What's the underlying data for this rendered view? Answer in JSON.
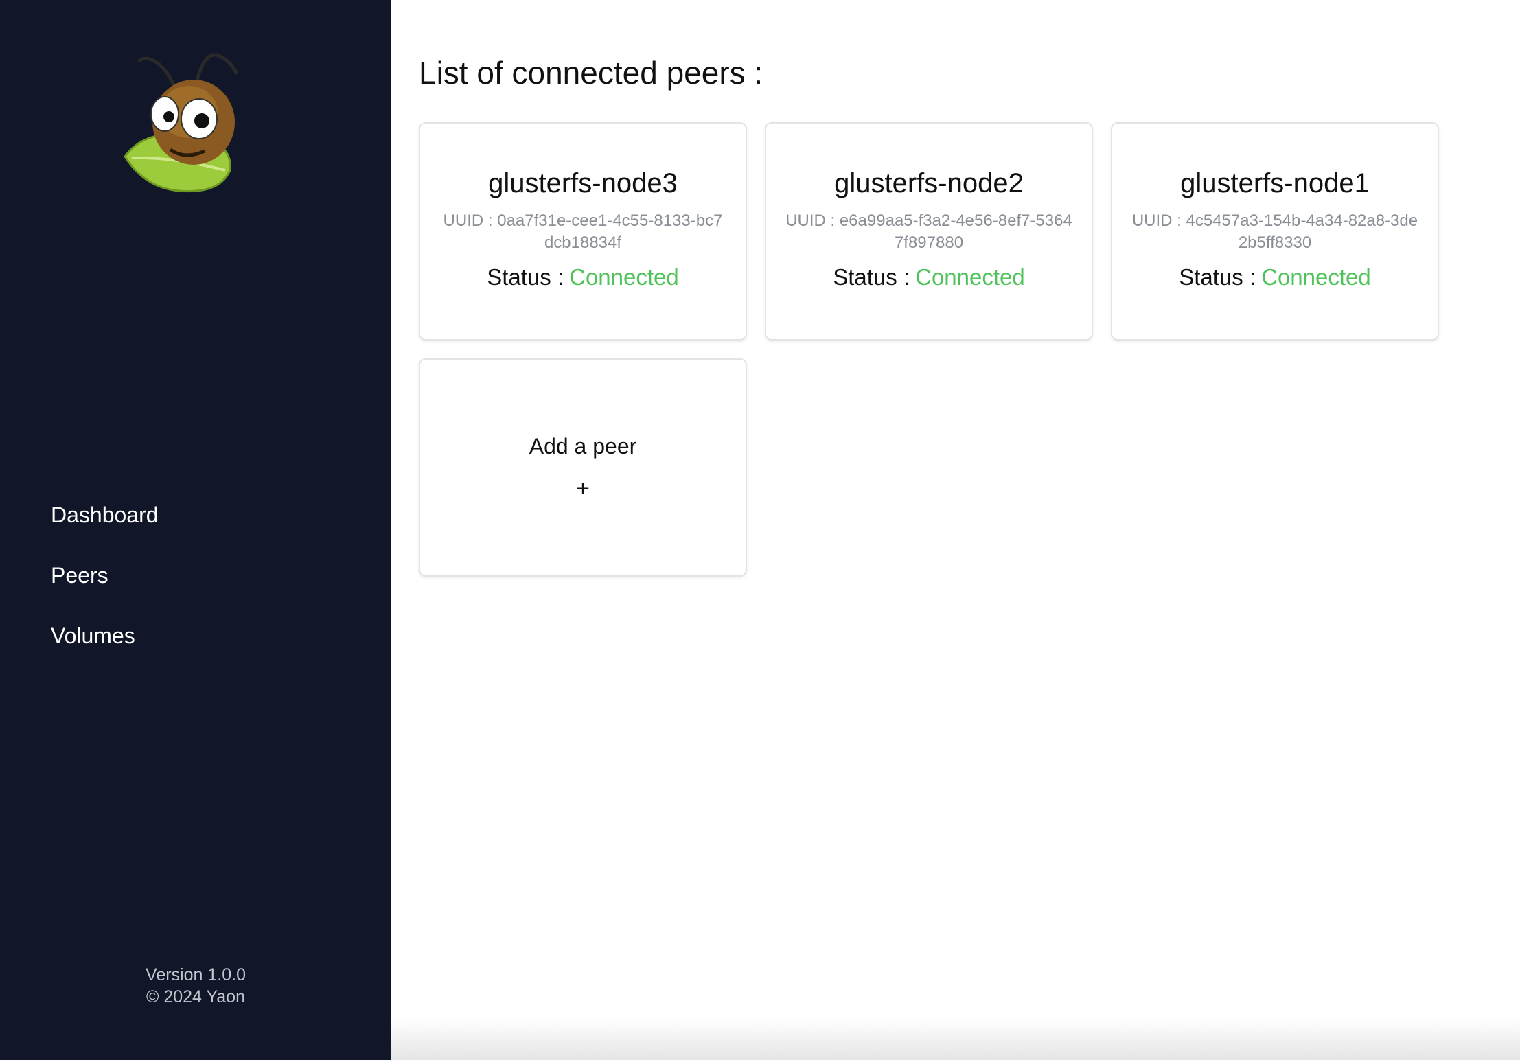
{
  "sidebar": {
    "nav": [
      {
        "label": "Dashboard"
      },
      {
        "label": "Peers"
      },
      {
        "label": "Volumes"
      }
    ],
    "footer": {
      "version": "Version 1.0.0",
      "copyright": "© 2024 Yaon"
    }
  },
  "main": {
    "title": "List of connected peers :",
    "peers": [
      {
        "name": "glusterfs-node3",
        "uuid": "UUID : 0aa7f31e-cee1-4c55-8133-bc7dcb18834f",
        "status_label": "Status :",
        "status": "Connected"
      },
      {
        "name": "glusterfs-node2",
        "uuid": "UUID : e6a99aa5-f3a2-4e56-8ef7-53647f897880",
        "status_label": "Status :",
        "status": "Connected"
      },
      {
        "name": "glusterfs-node1",
        "uuid": "UUID : 4c5457a3-154b-4a34-82a8-3de2b5ff8330",
        "status_label": "Status :",
        "status": "Connected"
      }
    ],
    "add_peer": {
      "label": "Add a peer",
      "icon": "+"
    }
  },
  "colors": {
    "sidebar_bg": "#111729",
    "status_connected": "#4fc35a"
  }
}
